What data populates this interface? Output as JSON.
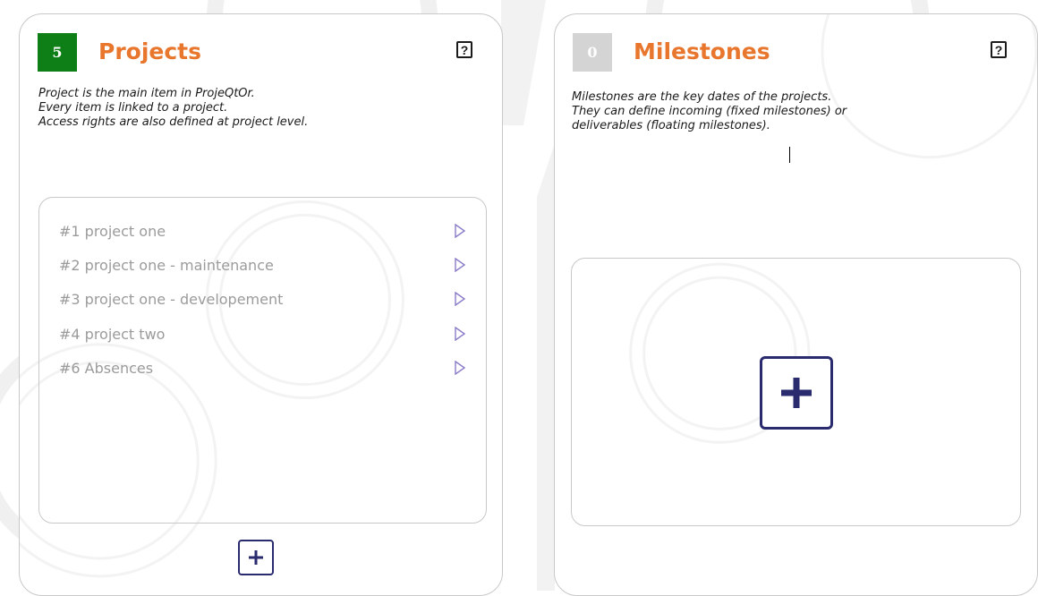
{
  "colors": {
    "title_orange": "#e8762d",
    "badge_green": "#0e7e16",
    "badge_grey": "#d4d4d4",
    "add_button_navy": "#2a2a6e",
    "row_text_grey": "#9b9b9b",
    "arrow_purple": "#8a7cc8"
  },
  "projects": {
    "count": "5",
    "title": "Projects",
    "help_label": "?",
    "description": [
      "Project is the main item in ProjeQtOr.",
      "Every item is linked to a project.",
      "Access rights are also defined at project level."
    ],
    "items": [
      {
        "label": "#1 project one"
      },
      {
        "label": "#2 project one - maintenance"
      },
      {
        "label": "#3 project one - developement"
      },
      {
        "label": "#4 project two"
      },
      {
        "label": "#6 Absences"
      }
    ],
    "add_icon": "plus-icon"
  },
  "milestones": {
    "count": "0",
    "title": "Milestones",
    "help_label": "?",
    "description": [
      "Milestones are the key dates of the projects.",
      "They can define incoming (fixed milestones) or",
      "deliverables (floating milestones)."
    ],
    "add_icon": "plus-icon"
  }
}
